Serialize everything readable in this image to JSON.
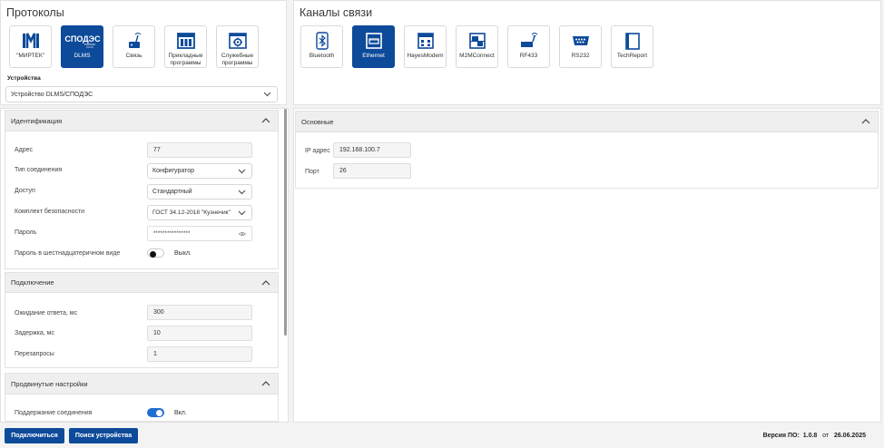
{
  "protocols": {
    "title": "Протоколы",
    "tiles": [
      {
        "label": "\"МИРТЕК\"",
        "icon": "mirtek-logo-icon",
        "active": false
      },
      {
        "label": "DLMS",
        "icon": "spodes-logo-icon",
        "logo_text": "СПОДЭС",
        "active": true
      },
      {
        "label": "Связь",
        "icon": "connection-icon",
        "active": false
      },
      {
        "label": "Прикладные программы",
        "icon": "applications-icon",
        "active": false
      },
      {
        "label": "Служебные программы",
        "icon": "service-programs-icon",
        "active": false
      }
    ],
    "device_label": "Устройства",
    "device_value": "Устройство DLMS/СПОДЭС"
  },
  "channels": {
    "title": "Каналы связи",
    "tiles": [
      {
        "label": "Bluetooth",
        "icon": "bluetooth-icon",
        "active": false
      },
      {
        "label": "Ethernet",
        "icon": "ethernet-icon",
        "active": true
      },
      {
        "label": "HayesModem",
        "icon": "modem-icon",
        "active": false
      },
      {
        "label": "M2MConnect",
        "icon": "m2m-icon",
        "active": false
      },
      {
        "label": "RF433",
        "icon": "rf433-icon",
        "active": false
      },
      {
        "label": "RS232",
        "icon": "rs232-icon",
        "active": false
      },
      {
        "label": "TechReport",
        "icon": "techreport-icon",
        "active": false
      }
    ]
  },
  "identification": {
    "title": "Идентификация",
    "address_label": "Адрес",
    "address_value": "77",
    "conn_type_label": "Тип соединения",
    "conn_type_value": "Конфигуратор",
    "access_label": "Доступ",
    "access_value": "Стандартный",
    "security_label": "Комплект безопасности",
    "security_value": "ГОСТ 34.12-2018 \"Кузнечик\"",
    "password_label": "Пароль",
    "password_value": "****************",
    "hex_label": "Пароль в шестнадцатеричном виде",
    "hex_toggle_text": "Выкл.",
    "hex_toggle_on": false
  },
  "connection": {
    "title": "Подключение",
    "timeout_label": "Ожидание ответа, мс",
    "timeout_value": "300",
    "delay_label": "Задержка, мс",
    "delay_value": "10",
    "retries_label": "Перезапросы",
    "retries_value": "1"
  },
  "advanced": {
    "title": "Продвинутые настройки",
    "keepalive_label": "Поддержание соединения",
    "keepalive_toggle_text": "Вкл.",
    "keepalive_toggle_on": true
  },
  "basic": {
    "title": "Основные",
    "ip_label": "IP адрес",
    "ip_value": "192.168.100.7",
    "port_label": "Порт",
    "port_value": "26"
  },
  "footer": {
    "connect_label": "Подключиться",
    "search_label": "Поиск устройства",
    "version_prefix": "Версия ПО:",
    "version": "1.0.8",
    "date_prefix": "от",
    "date": "26.06.2025"
  },
  "colors": {
    "accent": "#0d4a9a",
    "toggle_on": "#1f6fd1",
    "toggle_off_knob": "#111111"
  }
}
